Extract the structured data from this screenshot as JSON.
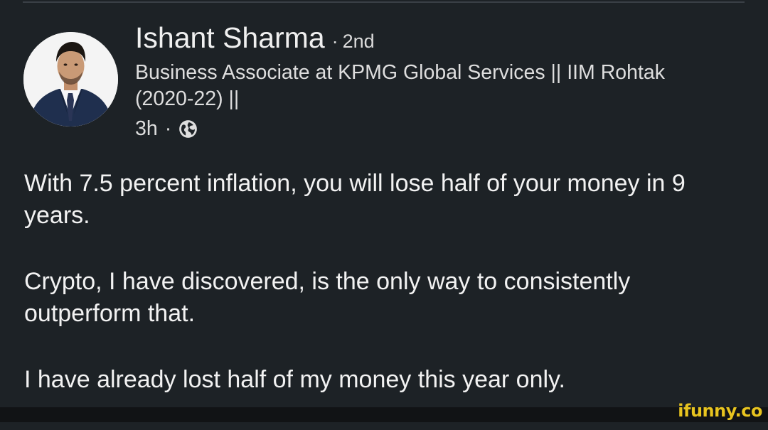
{
  "post": {
    "author": {
      "name": "Ishant Sharma",
      "separator": "·",
      "connection_degree": "2nd",
      "headline": "Business Associate at KPMG Global Services || IIM Rohtak (2020-22) ||"
    },
    "meta": {
      "time_ago": "3h",
      "dot": "·",
      "visibility_icon": "globe-icon"
    },
    "paragraphs": [
      "With 7.5 percent inflation, you will lose half of your money in 9 years.",
      "Crypto, I have discovered, is the only way to consistently outperform that.",
      "I have already lost half of my money this year only."
    ]
  },
  "watermark": {
    "text": "ifunny.co",
    "color": "#e8c41f"
  },
  "colors": {
    "background": "#1d2226",
    "text": "#f2f2f2"
  }
}
